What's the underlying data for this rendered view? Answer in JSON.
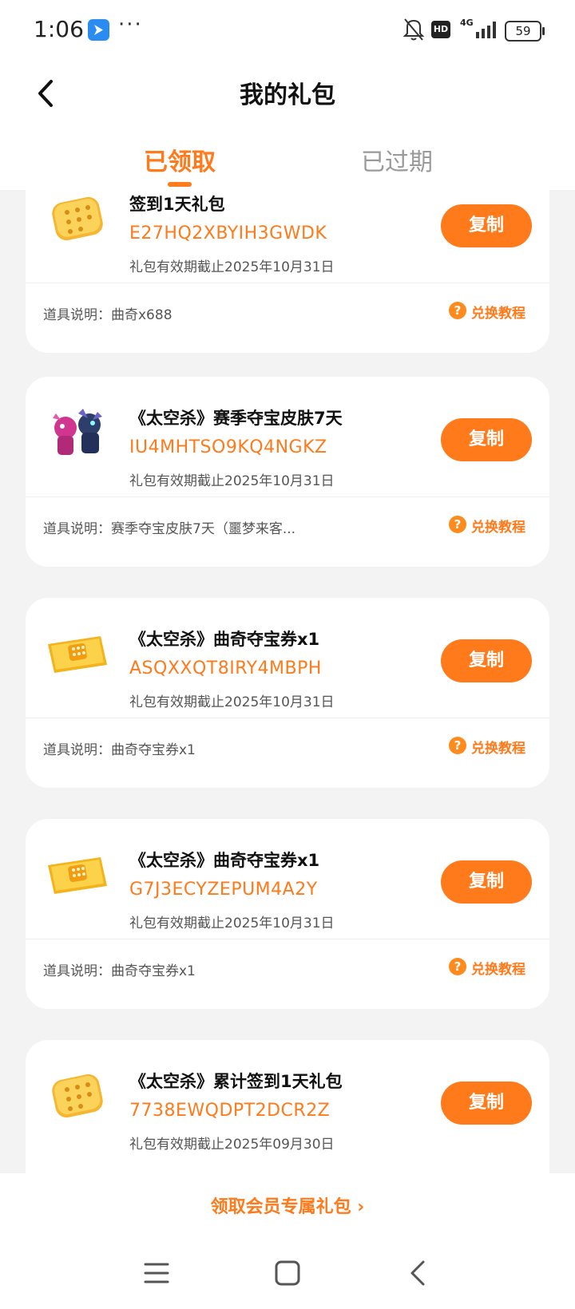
{
  "status": {
    "time": "1:06",
    "network": "4G",
    "hd": "HD",
    "battery": "59",
    "more": "···"
  },
  "header": {
    "title": "我的礼包"
  },
  "tabs": [
    {
      "label": "已领取"
    },
    {
      "label": "已过期"
    }
  ],
  "copy_label": "复制",
  "help_label": "兑换教程",
  "cards": [
    {
      "title": "签到1天礼包",
      "code": "E27HQ2XBYIH3GWDK",
      "expiry": "礼包有效期截止2025年10月31日",
      "desc": "道具说明：曲奇x688",
      "icon": "cookie-icon"
    },
    {
      "title": "《太空杀》赛季夺宝皮肤7天",
      "code": "IU4MHTSO9KQ4NGKZ",
      "expiry": "礼包有效期截止2025年10月31日",
      "desc": "道具说明：赛季夺宝皮肤7天（噩梦来客...",
      "icon": "skin-characters-icon"
    },
    {
      "title": "《太空杀》曲奇夺宝券x1",
      "code": "ASQXXQT8IRY4MBPH",
      "expiry": "礼包有效期截止2025年10月31日",
      "desc": "道具说明：曲奇夺宝券x1",
      "icon": "ticket-icon"
    },
    {
      "title": "《太空杀》曲奇夺宝券x1",
      "code": "G7J3ECYZEPUM4A2Y",
      "expiry": "礼包有效期截止2025年10月31日",
      "desc": "道具说明：曲奇夺宝券x1",
      "icon": "ticket-icon"
    },
    {
      "title": "《太空杀》累计签到1天礼包",
      "code": "7738EWQDPT2DCR2Z",
      "expiry": "礼包有效期截止2025年09月30日",
      "desc": "",
      "icon": "cookie-icon"
    }
  ],
  "vip_link": "领取会员专属礼包 ›",
  "colors": {
    "accent": "#ff7a1a",
    "background": "#f3f3f3"
  }
}
